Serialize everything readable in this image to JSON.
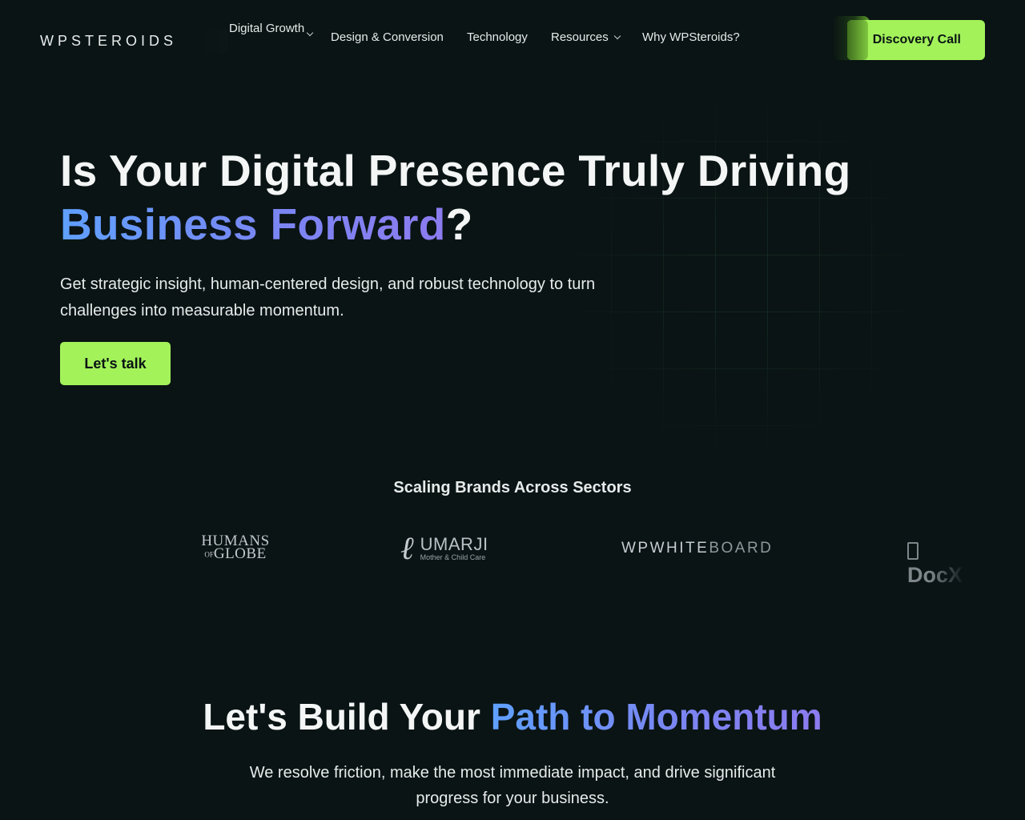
{
  "nav": {
    "logo": "WPSTEROIDS",
    "items": [
      {
        "label": "Digital Growth",
        "has_dropdown": true
      },
      {
        "label": "Design & Conversion",
        "has_dropdown": false
      },
      {
        "label": "Technology",
        "has_dropdown": false
      },
      {
        "label": "Resources",
        "has_dropdown": true
      },
      {
        "label": "Why WPSteroids?",
        "has_dropdown": false
      }
    ],
    "cta": "Discovery Call"
  },
  "hero": {
    "title_part1": "Is Your Digital Presence Truly Driving",
    "title_highlight": "Business Forward",
    "title_end": "?",
    "subtitle": "Get strategic insight, human-centered design, and robust technology to turn challenges into measurable momentum.",
    "button": "Let's talk"
  },
  "brands": {
    "title": "Scaling Brands Across Sectors",
    "logos": {
      "humans_line1": "HUMANS",
      "humans_small": "OF",
      "humans_line2": "GLOBE",
      "umarji_name": "UMARJI",
      "umarji_tag": "Mother & Child Care",
      "wpwhite": "WPWHITE",
      "board": "BOARD",
      "docx": "DocX"
    }
  },
  "path": {
    "title_part1": "Let's Build Your",
    "title_highlight": "Path to Momentum",
    "subtitle": "We resolve friction, make the most immediate impact, and drive significant progress for your business."
  },
  "colors": {
    "background": "#0a1414",
    "accent_green": "#a3f25a",
    "gradient_start": "#5fa0ff",
    "gradient_end": "#8c7bf0"
  }
}
